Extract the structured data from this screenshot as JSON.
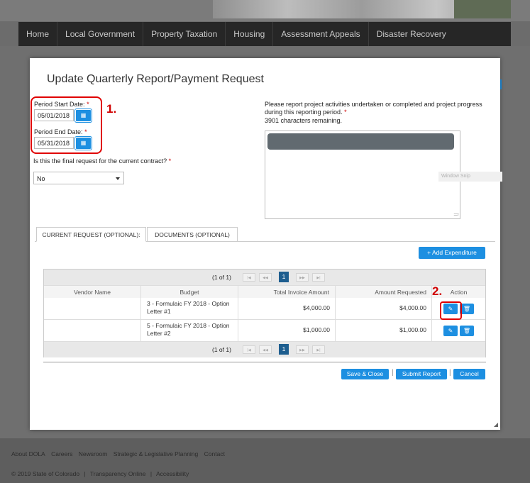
{
  "nav": {
    "items": [
      "Home",
      "Local Government",
      "Property Taxation",
      "Housing",
      "Assessment Appeals",
      "Disaster Recovery"
    ]
  },
  "modal": {
    "title": "Update Quarterly Report/Payment Request",
    "period_start_label": "Period Start Date:",
    "period_start_value": "05/01/2018",
    "period_end_label": "Period End Date:",
    "period_end_value": "05/31/2018",
    "required_mark": "*",
    "annotation_1": "1.",
    "annotation_2": "2.",
    "final_request_label": "Is this the final request for the current contract?",
    "final_request_value": "No",
    "report_label": "Please report project activities undertaken or completed and project progress during this reporting period.",
    "chars_remaining": "3901 characters remaining.",
    "tabs": [
      "CURRENT REQUEST (OPTIONAL):",
      "DOCUMENTS (OPTIONAL)"
    ],
    "add_expenditure_label": "+ Add Expenditure"
  },
  "grid": {
    "pager_info": "(1 of 1)",
    "current_page": "1",
    "pager_icons": [
      "first-page-icon",
      "prev-page-icon",
      "next-page-icon",
      "last-page-icon"
    ],
    "columns": [
      "Vendor Name",
      "Budget",
      "Total Invoice Amount",
      "Amount Requested",
      "Action"
    ],
    "rows": [
      {
        "vendor": "",
        "budget": "3 - Formulaic FY 2018 - Option Letter #1",
        "total_invoice": "$4,000.00",
        "amount_requested": "$4,000.00"
      },
      {
        "vendor": "",
        "budget": "5 - Formulaic FY 2018 - Option Letter #2",
        "total_invoice": "$1,000.00",
        "amount_requested": "$1,000.00"
      }
    ]
  },
  "actions": {
    "save_close": "Save & Close",
    "submit": "Submit Report",
    "cancel": "Cancel"
  },
  "overlay": {
    "window_snip": "Window Snip"
  },
  "footer": {
    "links": [
      "About DOLA",
      "Careers",
      "Newsroom",
      "Strategic & Legislative Planning",
      "Contact"
    ],
    "copyright": "© 2019 State of Colorado",
    "copy_links": [
      "Transparency Online",
      "Accessibility"
    ]
  },
  "colors": {
    "accent": "#1d8fe1",
    "annotation": "#e00000",
    "nav_bg": "#262626"
  }
}
